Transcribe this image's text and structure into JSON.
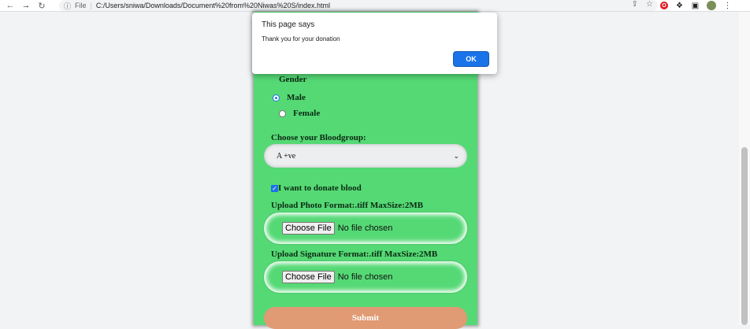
{
  "browser": {
    "url_scheme_label": "File",
    "url": "C:/Users/sniwa/Downloads/Document%20from%20Niwas%20S/index.html"
  },
  "dialog": {
    "title": "This page says",
    "message": "Thank you for your donation",
    "ok_label": "OK"
  },
  "form": {
    "gender_label": "Gender",
    "gender_options": [
      "Male",
      "Female"
    ],
    "gender_selected": "Male",
    "bloodgroup_label": "Choose your Bloodgroup:",
    "bloodgroup_value": "A +ve",
    "donate_label": "I want to donate blood",
    "donate_checked": true,
    "photo_label": "Upload Photo Format:.tiff MaxSize:2MB",
    "signature_label": "Upload Signature Format:.tiff MaxSize:2MB",
    "choose_file_label": "Choose File",
    "no_file_label": "No file chosen",
    "submit_label": "Submit"
  },
  "colors": {
    "form_background": "#55d975",
    "submit_background": "#e09a74",
    "accent": "#1a73e8"
  }
}
